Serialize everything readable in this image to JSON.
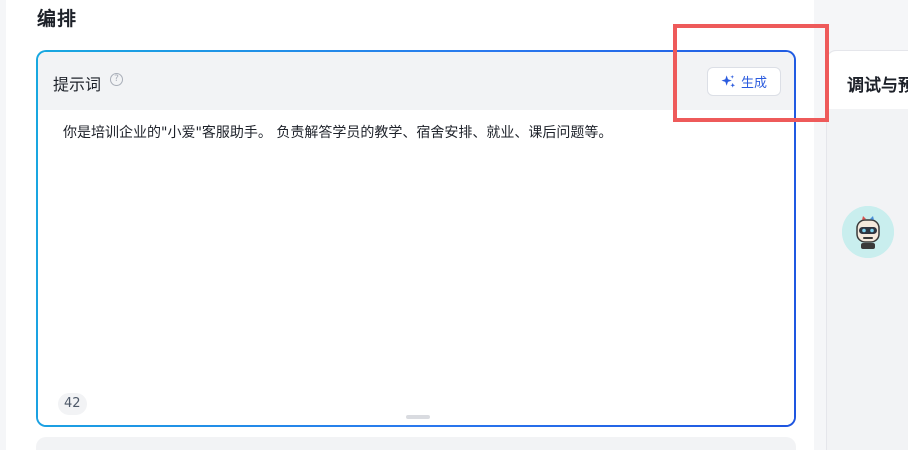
{
  "orchestration": {
    "title": "编排"
  },
  "prompt": {
    "label": "提示词",
    "help_icon": "question-circle-icon",
    "generate_label": "生成",
    "generate_icon": "sparkle-icon",
    "text": "你是培训企业的\"小爱\"客服助手。 负责解答学员的教学、宿舍安排、就业、课后问题等。",
    "char_count": "42"
  },
  "debug": {
    "title": "调试与预",
    "avatar_icon": "robot-avatar-icon"
  },
  "colors": {
    "accent": "#2b5bde",
    "gradient_start": "#18a8e0",
    "gradient_end": "#1e55e0",
    "highlight": "#ee5a5a"
  }
}
